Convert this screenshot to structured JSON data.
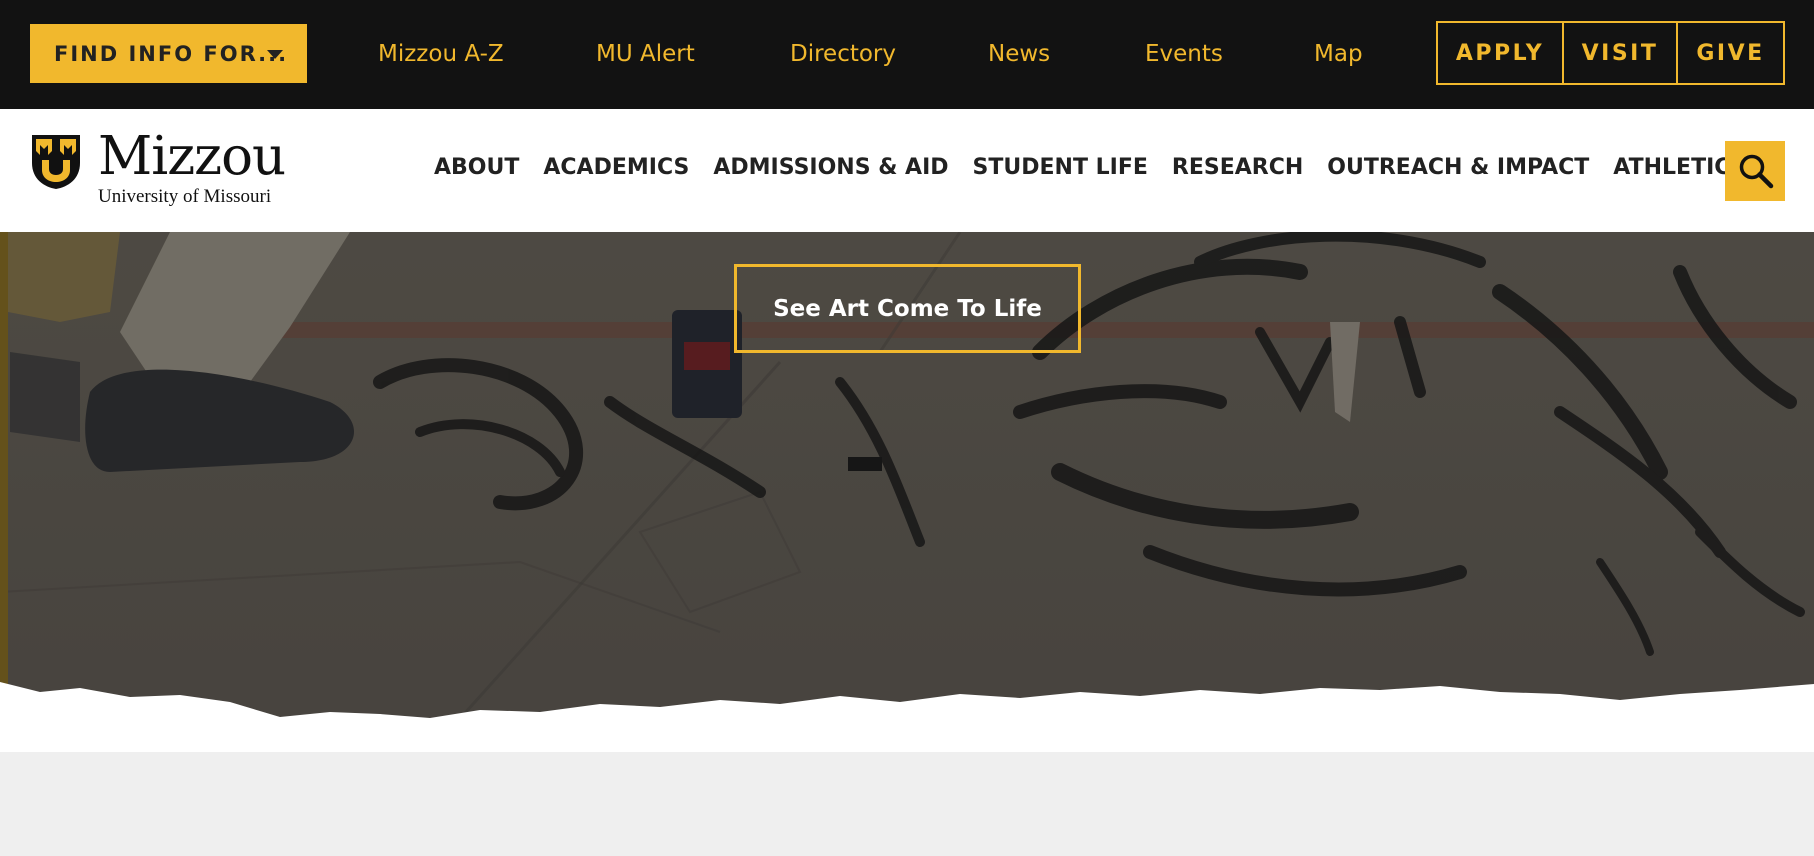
{
  "topbar": {
    "find_info_label": "FIND INFO FOR...",
    "links": [
      "Mizzou A-Z",
      "MU Alert",
      "Directory",
      "News",
      "Events",
      "Map"
    ],
    "cta": {
      "apply": "APPLY",
      "visit": "VISIT",
      "give": "GIVE"
    }
  },
  "header": {
    "logo_word": "Mizzou",
    "logo_sub": "University of Missouri",
    "nav": [
      "ABOUT",
      "ACADEMICS",
      "ADMISSIONS & AID",
      "STUDENT LIFE",
      "RESEARCH",
      "OUTREACH & IMPACT",
      "ATHLETICS"
    ],
    "search_icon": "search-icon"
  },
  "hero": {
    "cta_label": "See Art Come To Life"
  },
  "colors": {
    "gold": "#f1b82d",
    "black": "#121212",
    "white": "#ffffff",
    "page_gray": "#efefef"
  }
}
